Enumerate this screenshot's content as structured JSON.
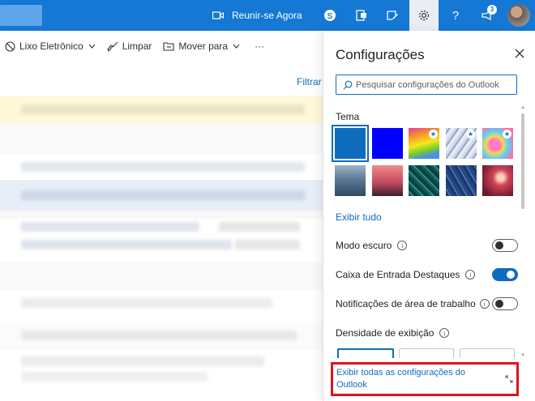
{
  "topbar": {
    "meet_label": "Reunir-se Agora",
    "notification_count": "3"
  },
  "commands": {
    "junk": "Lixo Eletrônico",
    "clean": "Limpar",
    "move": "Mover para",
    "more": "···"
  },
  "list": {
    "filter": "Filtrar"
  },
  "settings": {
    "title": "Configurações",
    "search_placeholder": "Pesquisar configurações do Outlook",
    "theme_label": "Tema",
    "show_all": "Exibir tudo",
    "dark_mode": "Modo escuro",
    "focused_inbox": "Caixa de Entrada Destaques",
    "desktop_notifications": "Notificações de área de trabalho",
    "display_density": "Densidade de exibição",
    "view_all_settings": "Exibir todas as configurações do Outlook",
    "toggles": {
      "dark_mode": false,
      "focused_inbox": true,
      "desktop_notifications": false
    },
    "themes": [
      {
        "name": "blue",
        "selected": true
      },
      {
        "name": "deep-blue",
        "selected": false
      },
      {
        "name": "rainbow",
        "selected": false,
        "starred": true
      },
      {
        "name": "abstract-lines",
        "selected": false,
        "starred": true
      },
      {
        "name": "unicorn",
        "selected": false,
        "starred": true
      },
      {
        "name": "mountain",
        "selected": false
      },
      {
        "name": "palms",
        "selected": false
      },
      {
        "name": "circuit",
        "selected": false
      },
      {
        "name": "blueprint",
        "selected": false
      },
      {
        "name": "bokeh",
        "selected": false
      }
    ]
  },
  "colors": {
    "brand": "#1478d4",
    "link": "#0f6cbd",
    "highlight_box": "#e0141b"
  }
}
